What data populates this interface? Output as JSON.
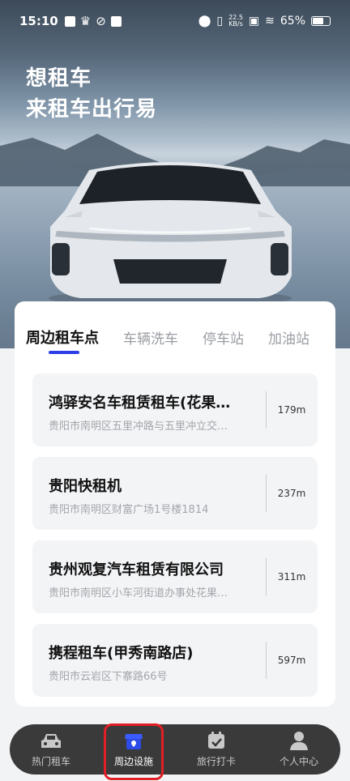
{
  "status_bar": {
    "time": "15:10",
    "net_speed_value": "22.5",
    "net_speed_unit": "KB/s",
    "battery": "65%",
    "battery_level": 0.65
  },
  "hero": {
    "line1": "想租车",
    "line2": "来租车出行易"
  },
  "tabs": [
    {
      "label": "周边租车点",
      "active": true
    },
    {
      "label": "车辆洗车",
      "active": false
    },
    {
      "label": "停车站",
      "active": false
    },
    {
      "label": "加油站",
      "active": false
    }
  ],
  "places": [
    {
      "name": "鸿驿安名车租赁租车(花果…",
      "address": "贵阳市南明区五里冲路与五里冲立交…",
      "distance": "179m"
    },
    {
      "name": "贵阳快租机",
      "address": "贵阳市南明区财富广场1号楼1814",
      "distance": "237m"
    },
    {
      "name": "贵州观复汽车租赁有限公司",
      "address": "贵阳市南明区小车河街道办事处花果…",
      "distance": "311m"
    },
    {
      "name": "携程租车(甲秀南路店)",
      "address": "贵阳市云岩区下寨路66号",
      "distance": "597m"
    }
  ],
  "nav": [
    {
      "label": "热门租车",
      "icon": "car-icon",
      "active": false
    },
    {
      "label": "周边设施",
      "icon": "location-store-icon",
      "active": true
    },
    {
      "label": "旅行打卡",
      "icon": "calendar-check-icon",
      "active": false
    },
    {
      "label": "个人中心",
      "icon": "user-icon",
      "active": false
    }
  ],
  "colors": {
    "accent": "#2c3de8",
    "nav_bg": "#3a3a3a",
    "highlight": "#e21f26"
  }
}
